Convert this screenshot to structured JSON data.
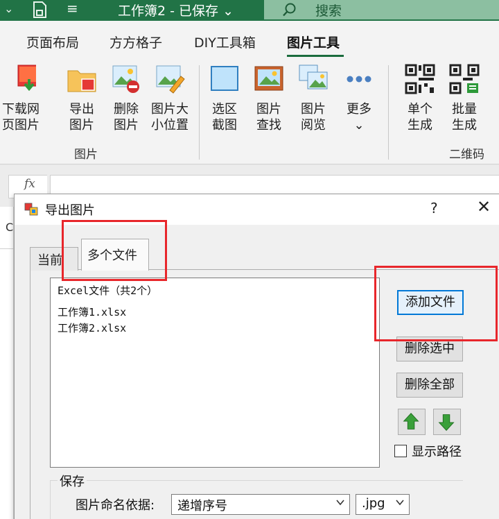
{
  "titlebar": {
    "title": "工作簿2 - 已保存",
    "title_caret": "⌄",
    "search_placeholder": "搜索",
    "accent": "#217346"
  },
  "ribbon": {
    "tabs": [
      "页面布局",
      "方方格子",
      "DIY工具箱",
      "图片工具"
    ],
    "active_tab": "图片工具",
    "buttons": {
      "download": [
        "下载网",
        "页图片"
      ],
      "export": [
        "导出",
        "图片"
      ],
      "delete": [
        "删除",
        "图片"
      ],
      "resize": [
        "图片大",
        "小位置"
      ],
      "screenshot": [
        "选区",
        "截图"
      ],
      "find": [
        "图片",
        "查找"
      ],
      "browse": [
        "图片",
        "阅览"
      ],
      "more": [
        "更多",
        "⌄"
      ],
      "single": [
        "单个",
        "生成"
      ],
      "batch": [
        "批量",
        "生成"
      ]
    },
    "groups": {
      "picture": "图片",
      "qrcode": "二维码"
    }
  },
  "formula_bar": {
    "fx": "fx",
    "cell_letter": "C"
  },
  "dialog": {
    "title": "导出图片",
    "help": "?",
    "close": "✕",
    "tabs": {
      "current": "当前",
      "multi": "多个文件"
    },
    "file_list": {
      "header": "Excel文件（共2个）",
      "items": [
        "工作簿1.xlsx",
        "工作簿2.xlsx"
      ]
    },
    "buttons": {
      "add": "添加文件",
      "remove_selected": "删除选中",
      "remove_all": "删除全部"
    },
    "show_path": "显示路径",
    "save": {
      "legend": "保存",
      "name_label": "图片命名依据:",
      "name_value": "递增序号",
      "ext_value": ".jpg"
    },
    "highlight_color": "#e8262b"
  }
}
